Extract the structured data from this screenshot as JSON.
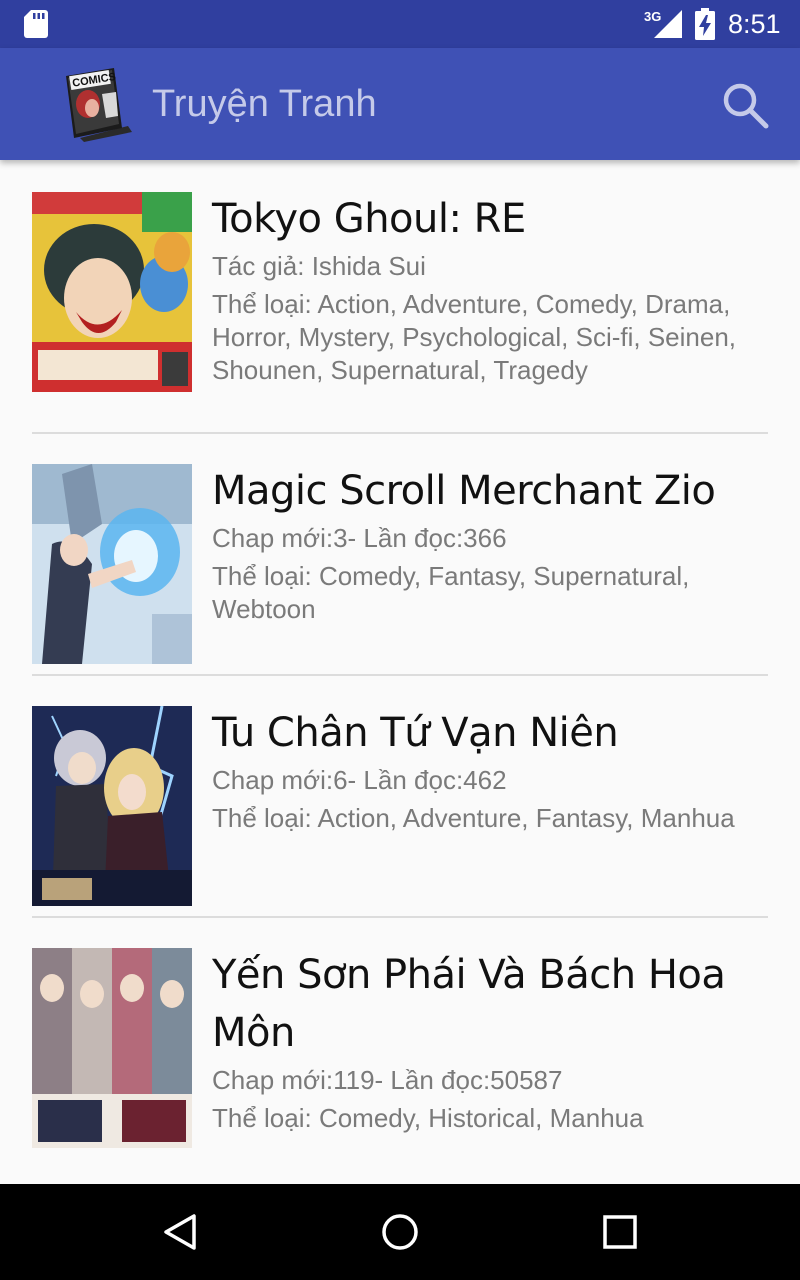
{
  "status_bar": {
    "network": "3G",
    "time": "8:51",
    "icons": [
      "sd-card-icon",
      "signal-icon",
      "battery-charging-icon"
    ]
  },
  "app_bar": {
    "title": "Truyện Tranh",
    "logo_icon": "comics-book-logo",
    "logo_text": "COMICS",
    "search_icon": "search-icon"
  },
  "comics": [
    {
      "title": "Tokyo Ghoul: RE",
      "meta": "Tác giả: Ishida Sui",
      "genres": "Thể loại: Action, Adventure, Comedy, Drama, Horror, Mystery, Psychological, Sci-fi, Seinen, Shounen, Supernatural, Tragedy"
    },
    {
      "title": "Magic Scroll Merchant Zio",
      "meta": "Chap mới:3- Lần đọc:366",
      "genres": "Thể loại: Comedy, Fantasy, Supernatural, Webtoon"
    },
    {
      "title": "Tu Chân Tứ Vạn Niên",
      "meta": "Chap mới:6- Lần đọc:462",
      "genres": "Thể loại: Action, Adventure, Fantasy, Manhua"
    },
    {
      "title": "Yến Sơn Phái Và Bách Hoa Môn",
      "meta": "Chap mới:119- Lần đọc:50587",
      "genres": "Thể loại: Comedy, Historical, Manhua"
    }
  ],
  "nav_bar": {
    "icons": [
      "back-icon",
      "home-icon",
      "recents-icon"
    ]
  },
  "colors": {
    "status_bar": "#303f9f",
    "app_bar": "#3f51b5",
    "title_text": "#c5cae9",
    "background": "#fafafa",
    "secondary_text": "#7a7a7a"
  }
}
